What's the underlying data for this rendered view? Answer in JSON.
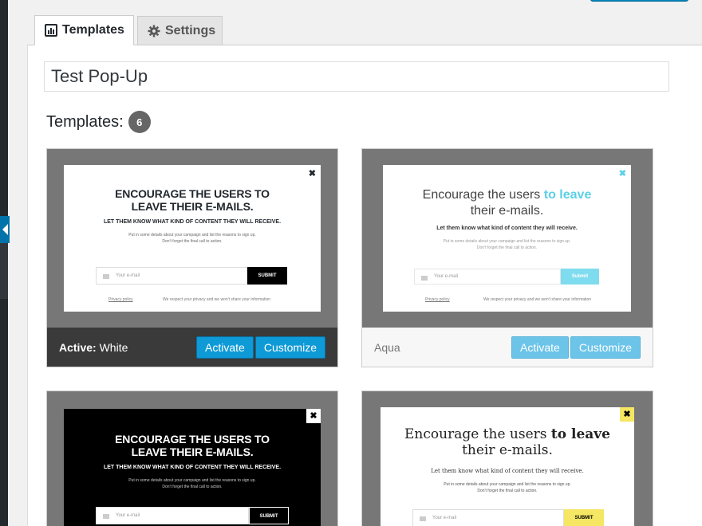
{
  "tabs": [
    {
      "label": "Templates",
      "icon": "chart-icon"
    },
    {
      "label": "Settings",
      "icon": "gear-icon"
    }
  ],
  "popup_title": "Test Pop-Up",
  "templates_heading": "Templates:",
  "templates_count": "6",
  "cards": [
    {
      "active_prefix": "Active:",
      "name": "White",
      "activate_label": "Activate",
      "customize_label": "Customize",
      "popup": {
        "heading": "ENCOURAGE THE USERS TO LEAVE THEIR E-MAILS.",
        "subheading": "LET THEM KNOW WHAT KIND OF CONTENT THEY WILL RECEIVE.",
        "desc_line1": "Put in some details about your campaign and list the reasons to sign up.",
        "desc_line2": "Don't forget the final call to action.",
        "email_placeholder": "Your e-mail",
        "submit": "SUBMIT",
        "privacy": "Privacy policy",
        "note": "We respect your privacy and we won't share your information"
      }
    },
    {
      "name": "Aqua",
      "activate_label": "Activate",
      "customize_label": "Customize",
      "popup": {
        "heading_start": "Encourage the users",
        "heading_accent": "to leave",
        "heading_end": "their e-mails.",
        "subheading": "Let them know what kind of content they will receive.",
        "desc_line1": "Put in some details about your campaign and list the reasons to sign up.",
        "desc_line2": "Don't forget the final call to action.",
        "email_placeholder": "Your e-mail",
        "submit": "Submit",
        "privacy": "Privacy policy",
        "note": "We respect your privacy and we won't share your information"
      }
    },
    {
      "popup": {
        "heading": "ENCOURAGE THE USERS TO LEAVE THEIR E-MAILS.",
        "subheading": "LET THEM KNOW WHAT KIND OF CONTENT THEY WILL RECEIVE.",
        "desc_line1": "Put in some details about your campaign and list the reasons to sign up.",
        "desc_line2": "Don't forget the final call to action.",
        "email_placeholder": "Your e-mail",
        "submit": "SUBMIT"
      }
    },
    {
      "popup": {
        "heading_start": "Encourage the users",
        "heading_accent": "to leave",
        "heading_end": "their e-mails.",
        "subheading": "Let them know what kind of content they will receive.",
        "desc_line1": "Put in some details about your campaign and list the reasons to sign up.",
        "desc_line2": "Don't forget the final call to action.",
        "email_placeholder": "Your e-mail",
        "submit": "SUBMIT"
      }
    }
  ],
  "colors": {
    "primary_button": "#0e9ad6",
    "aqua_accent": "#5bd0e6",
    "yellow_accent": "#f5e663"
  }
}
